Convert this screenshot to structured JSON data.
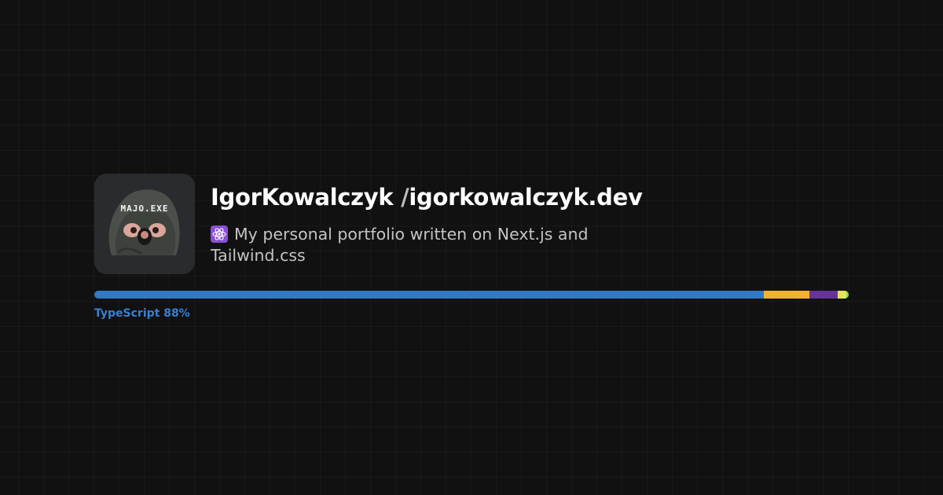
{
  "repo": {
    "owner": "IgorKowalczyk",
    "separator": "/",
    "name": "igorkowalczyk.dev",
    "avatar_text": "MAJO.EXE",
    "description": "My personal portfolio written on Next.js and Tailwind.css",
    "description_icon": "react-atom-icon"
  },
  "languages": {
    "label": "TypeScript 88%",
    "segments": [
      {
        "color": "#3178c6",
        "percent": 88.8
      },
      {
        "color": "#f1b22f",
        "percent": 6.0
      },
      {
        "color": "#663399",
        "percent": 3.7
      },
      {
        "color": "#e3e45c",
        "percent": 1.2
      },
      {
        "color": "#89e051",
        "percent": 0.3
      }
    ]
  }
}
